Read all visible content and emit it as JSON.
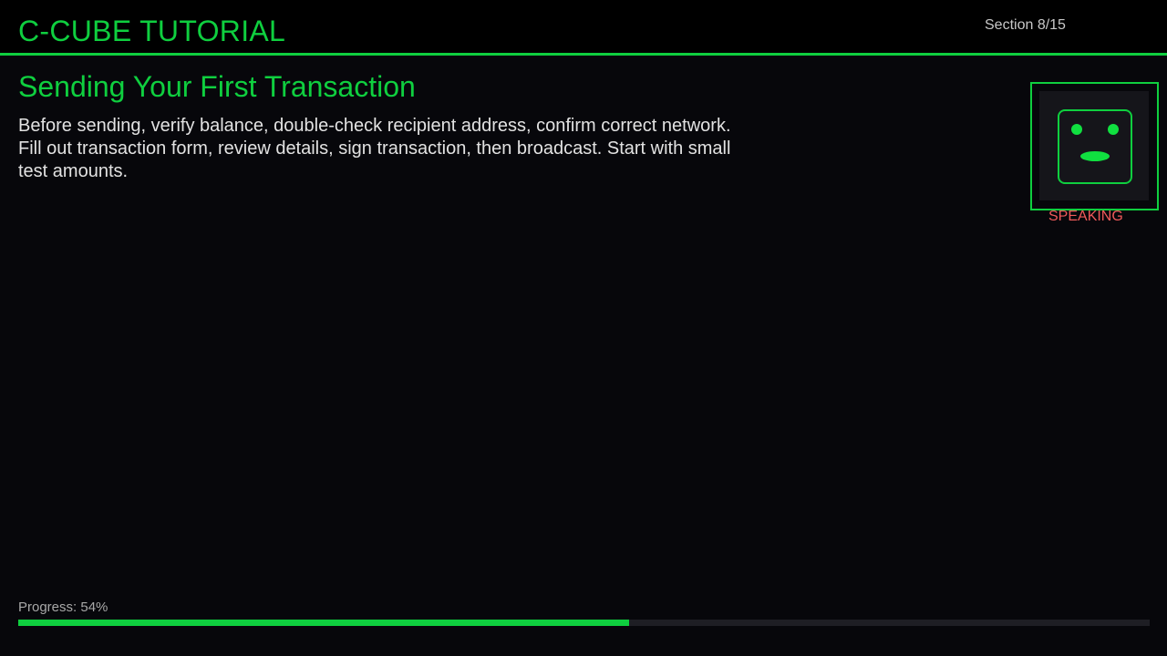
{
  "header": {
    "app_title": "C-CUBE TUTORIAL",
    "section_counter": "Section 8/15"
  },
  "lesson": {
    "title": "Sending Your First Transaction",
    "body": "Before sending, verify balance, double-check recipient address, confirm correct network. Fill out transaction form, review details, sign transaction, then broadcast. Start with small test amounts."
  },
  "avatar": {
    "status": "SPEAKING",
    "icon": "robot-face-icon"
  },
  "progress": {
    "label": "Progress: 54%",
    "percent": 54
  },
  "colors": {
    "accent": "#0fcf3f",
    "background": "#07070b",
    "header_bg": "#000000",
    "status_speaking": "#f05a5a",
    "body_text": "#e2e2e2"
  }
}
